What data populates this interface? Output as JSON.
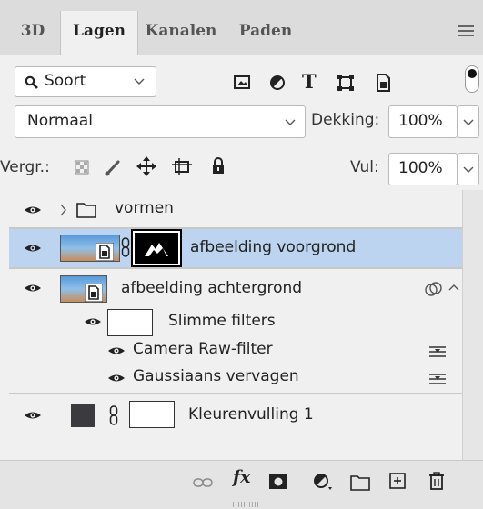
{
  "tabs": [
    "3D",
    "Lagen",
    "Kanalen",
    "Paden"
  ],
  "filter": {
    "label": "Soort"
  },
  "blend": {
    "mode": "Normaal",
    "opacity_label": "Dekking:",
    "opacity_value": "100%"
  },
  "lock": {
    "label": "Vergr.:",
    "fill_label": "Vul:",
    "fill_value": "100%"
  },
  "layers": {
    "group": "vormen",
    "foreground": "afbeelding voorgrond",
    "background": "afbeelding achtergrond",
    "smart_filters": "Slimme filters",
    "filter1": "Camera Raw-filter",
    "filter2": "Gaussiaans vervagen",
    "fill": "Kleurenvulling 1"
  },
  "colors": {
    "selected_row": "#bcd4ef",
    "fill_swatch": "#3a3a3f"
  },
  "icons": [
    "search-icon",
    "chevron-down-icon",
    "image-filter-icon",
    "adjustment-filter-icon",
    "type-filter-icon",
    "shape-filter-icon",
    "smart-object-filter-icon",
    "link-icon",
    "fx-icon",
    "mask-icon",
    "adjustment-icon",
    "folder-icon",
    "new-layer-icon",
    "trash-icon"
  ]
}
